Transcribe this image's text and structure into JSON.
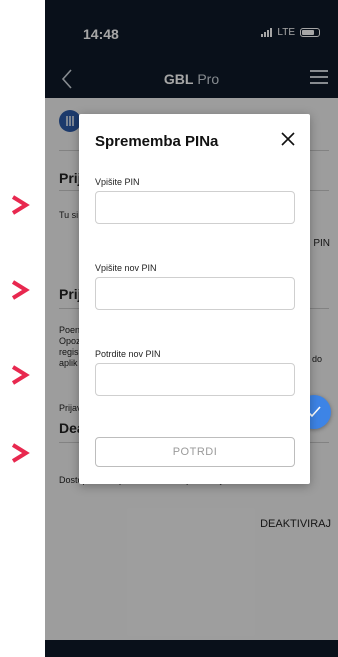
{
  "status": {
    "time": "14:48",
    "network": "LTE"
  },
  "nav": {
    "title_bold": "GBL",
    "title_rest": " Pro"
  },
  "background": {
    "sec1_title": "Prij",
    "sec1_text": "Tu si",
    "pin_label": "PIN",
    "sec2_title": "Prij",
    "sec2_lines": [
      "Poen",
      "Opoz",
      "regis",
      "aplik"
    ],
    "sec2_end": "do",
    "prijav_text": "Prijav",
    "sec3_title": "Dea",
    "sec3_text": "Dostop iz te naprave lahko izklopite tukaj.",
    "deactivate_label": "DEAKTIVIRAJ"
  },
  "modal": {
    "title": "Sprememba PINa",
    "fields": [
      {
        "label": "Vpišite PIN",
        "value": ""
      },
      {
        "label": "Vpišite nov PIN",
        "value": ""
      },
      {
        "label": "Potrdite nov PIN",
        "value": ""
      }
    ],
    "confirm_label": "POTRDI"
  },
  "icons": {
    "arrows": "chevron-right-icon",
    "back": "back-arrow-icon",
    "menu": "hamburger-menu-icon",
    "close": "close-icon",
    "fab": "checkmark-icon"
  },
  "colors": {
    "arrow": "#e8284f",
    "dark": "#0e1a28",
    "fab": "#3d84e6"
  }
}
